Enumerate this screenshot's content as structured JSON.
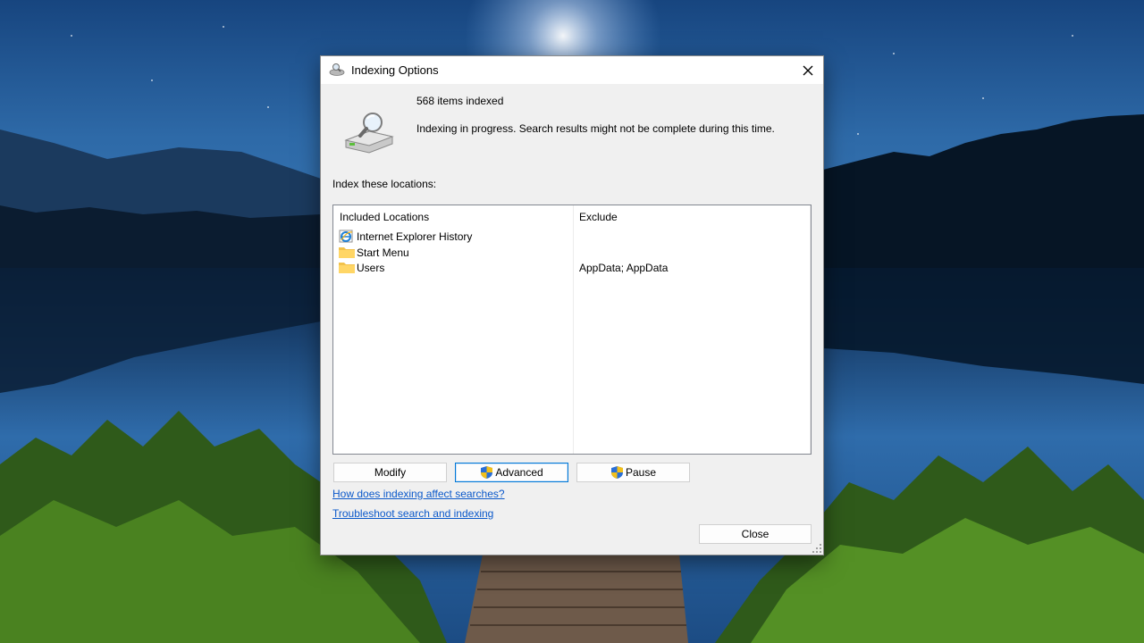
{
  "window": {
    "title": "Indexing Options",
    "close_glyph": "✕"
  },
  "status": {
    "count_text": "568 items indexed",
    "message": "Indexing in progress. Search results might not be complete during this time."
  },
  "locations": {
    "label": "Index these locations:",
    "headers": {
      "included": "Included Locations",
      "exclude": "Exclude"
    },
    "rows": [
      {
        "name": "Internet Explorer History",
        "icon": "ie-icon",
        "exclude": ""
      },
      {
        "name": "Start Menu",
        "icon": "folder-icon",
        "exclude": ""
      },
      {
        "name": "Users",
        "icon": "folder-icon",
        "exclude": "AppData; AppData"
      }
    ]
  },
  "buttons": {
    "modify": "Modify",
    "advanced": "Advanced",
    "pause": "Pause",
    "close": "Close"
  },
  "links": {
    "how": "How does indexing affect searches?",
    "troubleshoot": "Troubleshoot search and indexing"
  },
  "colors": {
    "link": "#0a58ca",
    "focus_border": "#0078d7",
    "dialog_bg": "#f0f0f0"
  }
}
